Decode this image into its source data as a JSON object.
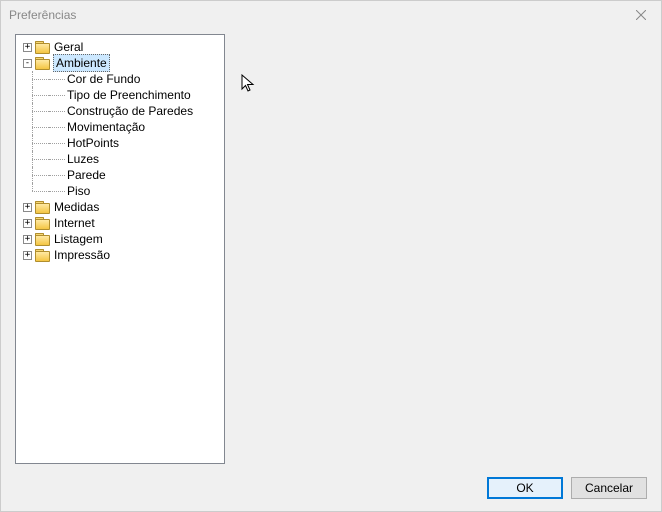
{
  "window": {
    "title": "Preferências"
  },
  "tree": {
    "geral": "Geral",
    "ambiente": {
      "label": "Ambiente",
      "children": [
        "Cor de Fundo",
        "Tipo de Preenchimento",
        "Construção de Paredes",
        "Movimentação",
        "HotPoints",
        "Luzes",
        "Parede",
        "Piso"
      ]
    },
    "medidas": "Medidas",
    "internet": "Internet",
    "listagem": "Listagem",
    "impressao": "Impressão"
  },
  "buttons": {
    "ok": "OK",
    "cancel": "Cancelar"
  }
}
